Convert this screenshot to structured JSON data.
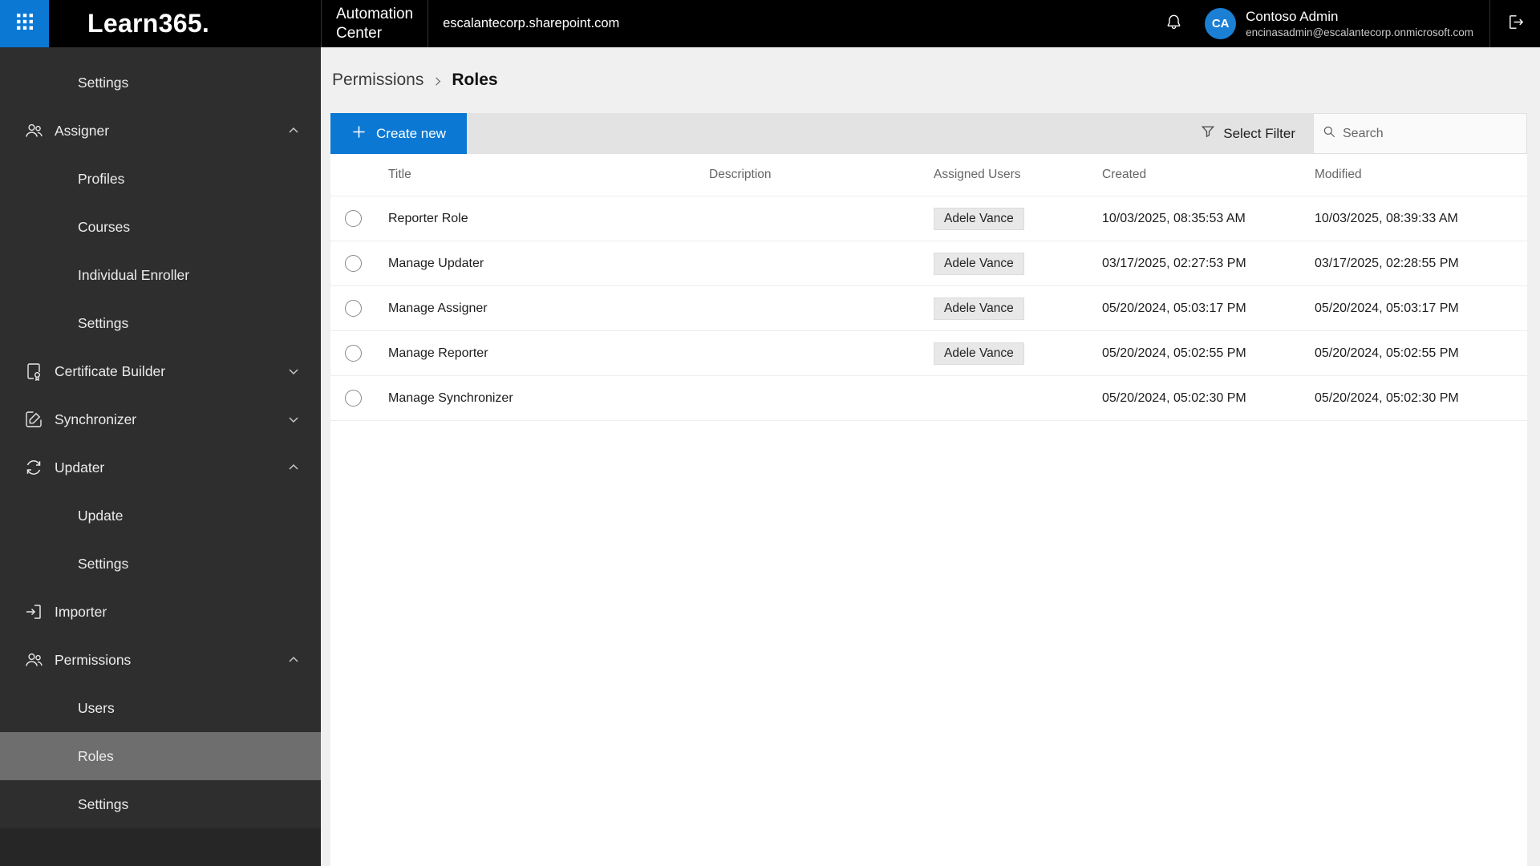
{
  "colors": {
    "accent_blue": "#0b78d4",
    "topbar_bg": "#000000",
    "sidebar_bg": "#2e2e2e",
    "sidebar_selected_bg": "#6e6e6e",
    "avatar_bg": "#1b7fd4",
    "toolbar_bg": "#e3e3e3",
    "main_bg": "#f0f0f0"
  },
  "topbar": {
    "logo": "Learn365.",
    "app_name_line1": "Automation",
    "app_name_line2": "Center",
    "site_url": "escalantecorp.sharepoint.com",
    "user": {
      "initials": "CA",
      "name": "Contoso Admin",
      "email": "encinasadmin@escalantecorp.onmicrosoft.com"
    }
  },
  "sidebar": {
    "items": [
      {
        "label": "Settings",
        "type": "sub"
      },
      {
        "label": "Assigner",
        "type": "parent",
        "icon": "people",
        "chevron": "up"
      },
      {
        "label": "Profiles",
        "type": "sub"
      },
      {
        "label": "Courses",
        "type": "sub"
      },
      {
        "label": "Individual Enroller",
        "type": "sub"
      },
      {
        "label": "Settings",
        "type": "sub"
      },
      {
        "label": "Certificate Builder",
        "type": "parent",
        "icon": "certificate",
        "chevron": "down"
      },
      {
        "label": "Synchronizer",
        "type": "parent",
        "icon": "sync-edit",
        "chevron": "down"
      },
      {
        "label": "Updater",
        "type": "parent",
        "icon": "refresh",
        "chevron": "up"
      },
      {
        "label": "Update",
        "type": "sub"
      },
      {
        "label": "Settings",
        "type": "sub"
      },
      {
        "label": "Importer",
        "type": "parent",
        "icon": "import"
      },
      {
        "label": "Permissions",
        "type": "parent",
        "icon": "people",
        "chevron": "up"
      },
      {
        "label": "Users",
        "type": "sub"
      },
      {
        "label": "Roles",
        "type": "sub",
        "selected": true
      },
      {
        "label": "Settings",
        "type": "sub"
      }
    ]
  },
  "breadcrumb": {
    "parent": "Permissions",
    "current": "Roles"
  },
  "toolbar": {
    "create_new_label": "Create new",
    "filter_label": "Select Filter",
    "search_placeholder": "Search"
  },
  "table": {
    "columns": [
      "Title",
      "Description",
      "Assigned Users",
      "Created",
      "Modified"
    ],
    "rows": [
      {
        "title": "Reporter Role",
        "description": "",
        "assigned_users": [
          "Adele Vance"
        ],
        "created": "10/03/2025, 08:35:53 AM",
        "modified": "10/03/2025, 08:39:33 AM"
      },
      {
        "title": "Manage Updater",
        "description": "",
        "assigned_users": [
          "Adele Vance"
        ],
        "created": "03/17/2025, 02:27:53 PM",
        "modified": "03/17/2025, 02:28:55 PM"
      },
      {
        "title": "Manage Assigner",
        "description": "",
        "assigned_users": [
          "Adele Vance"
        ],
        "created": "05/20/2024, 05:03:17 PM",
        "modified": "05/20/2024, 05:03:17 PM"
      },
      {
        "title": "Manage Reporter",
        "description": "",
        "assigned_users": [
          "Adele Vance"
        ],
        "created": "05/20/2024, 05:02:55 PM",
        "modified": "05/20/2024, 05:02:55 PM"
      },
      {
        "title": "Manage Synchronizer",
        "description": "",
        "assigned_users": [],
        "created": "05/20/2024, 05:02:30 PM",
        "modified": "05/20/2024, 05:02:30 PM"
      }
    ]
  }
}
